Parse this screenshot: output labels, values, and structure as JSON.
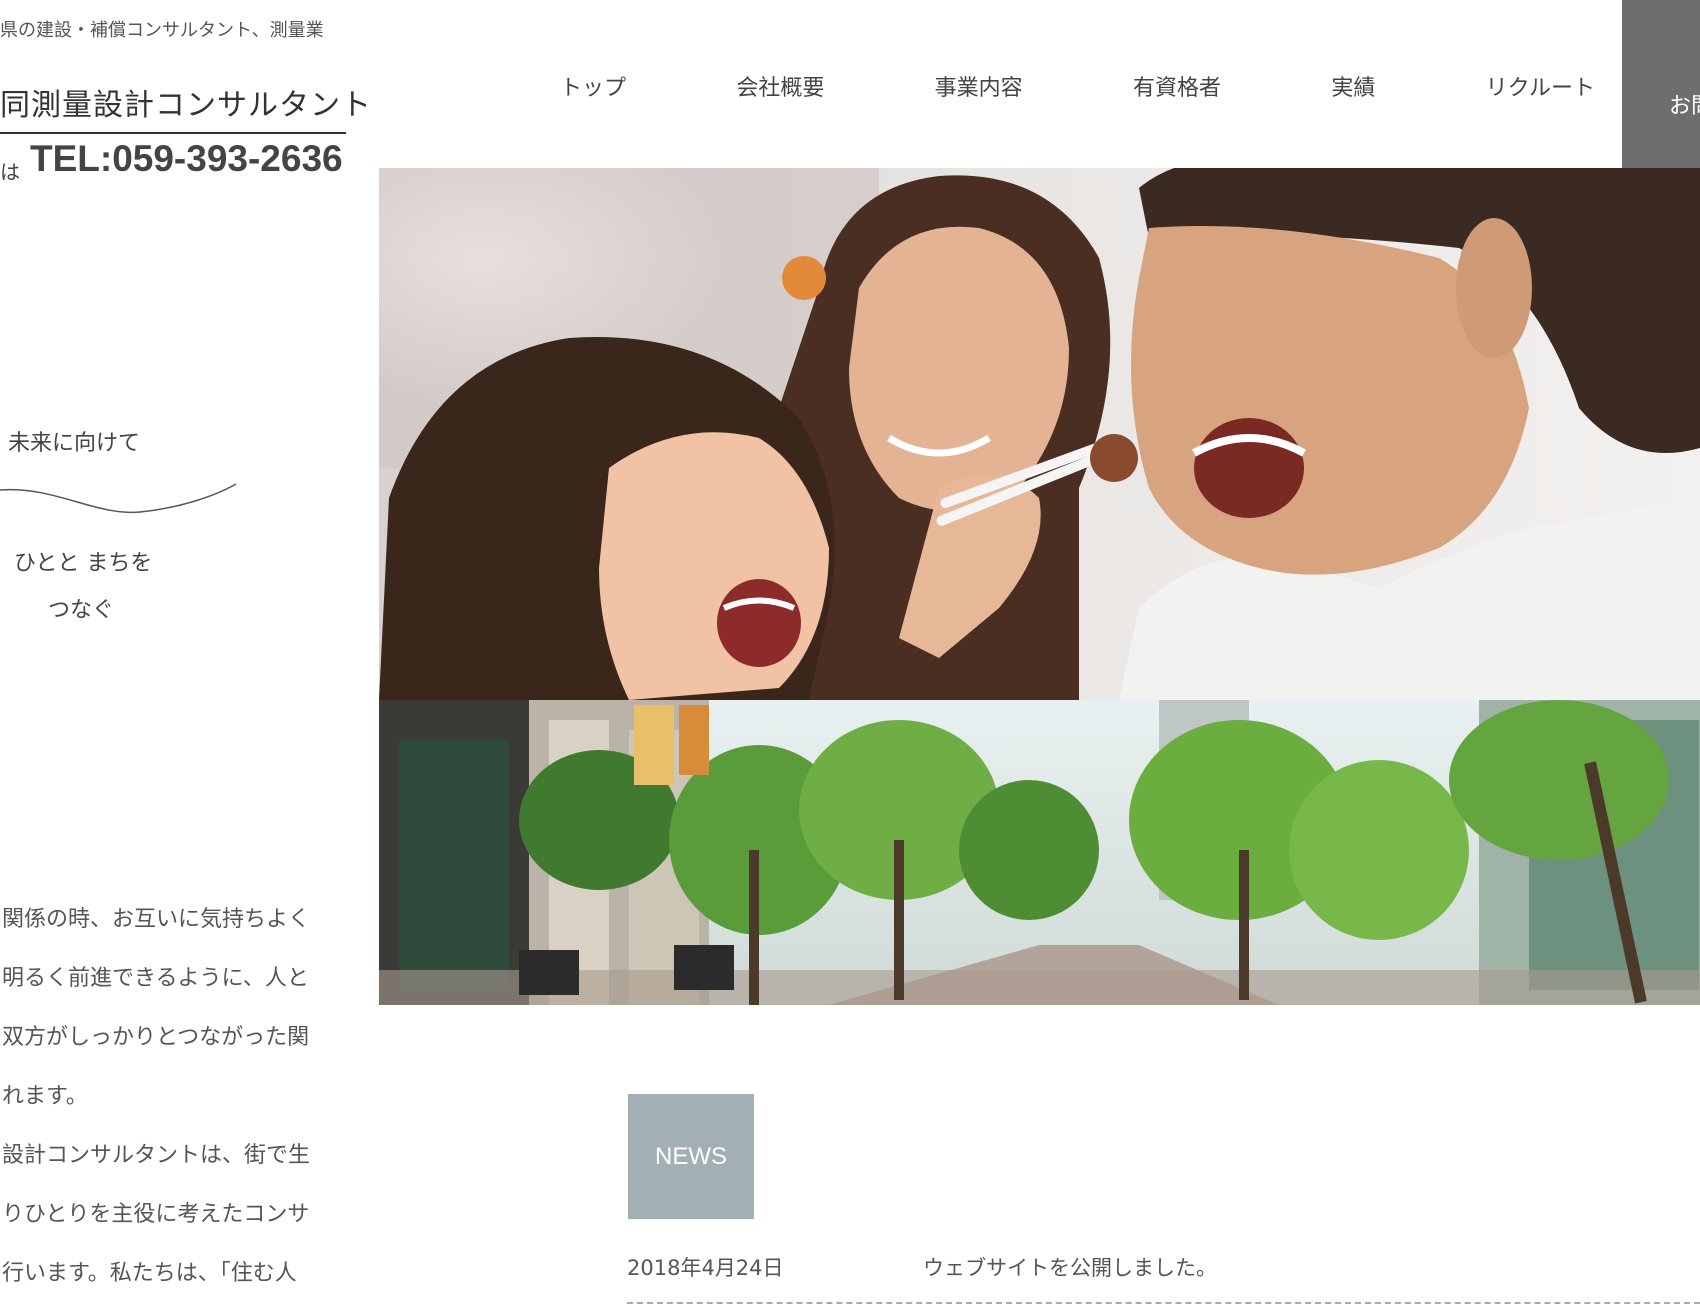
{
  "header": {
    "tagline": "県の建設・補償コンサルタント、測量業",
    "company_name": "同測量設計コンサルタント",
    "tel_prefix": "は",
    "tel": "TEL:059-393-2636"
  },
  "nav": {
    "items": [
      "トップ",
      "会社概要",
      "事業内容",
      "有資格者",
      "実績",
      "リクルート"
    ],
    "contact_label": "お問"
  },
  "side_copy": {
    "line1": "未来に向けて",
    "line2": "ひとと まちを",
    "line3": "つなぐ"
  },
  "body_text": {
    "lines": [
      "関係の時、お互いに気持ちよく",
      "明るく前進できるように、人と",
      "双方がしっかりとつながった関",
      "れます。",
      "設計コンサルタントは、街で生",
      "りひとりを主役に考えたコンサ",
      "行います。私たちは、「住む人"
    ]
  },
  "news": {
    "badge": "NEWS",
    "items": [
      {
        "date": "2018年4月24日",
        "text": "ウェブサイトを公開しました。"
      }
    ]
  }
}
